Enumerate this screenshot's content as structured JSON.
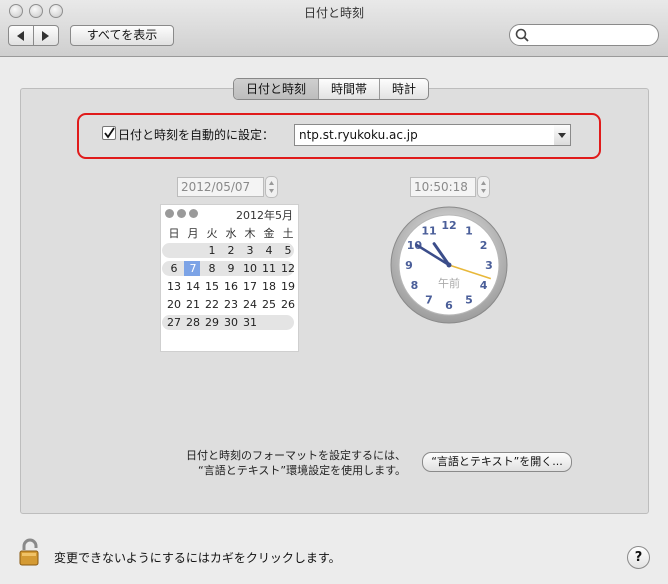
{
  "window": {
    "title": "日付と時刻"
  },
  "toolbar": {
    "show_all_label": "すべてを表示",
    "search_placeholder": ""
  },
  "tabs": [
    {
      "label": "日付と時刻",
      "selected": true
    },
    {
      "label": "時間帯",
      "selected": false
    },
    {
      "label": "時計",
      "selected": false
    }
  ],
  "auto_time": {
    "checked": true,
    "label": "日付と時刻を自動的に設定：",
    "server": "ntp.st.ryukoku.ac.jp"
  },
  "date_field": {
    "value": "2012/05/07"
  },
  "time_field": {
    "value": "10:50:18"
  },
  "calendar": {
    "month_label": "2012年5月",
    "weekdays": [
      "日",
      "月",
      "火",
      "水",
      "木",
      "金",
      "土"
    ],
    "weeks": [
      [
        "",
        "",
        "1",
        "2",
        "3",
        "4",
        "5"
      ],
      [
        "6",
        "7",
        "8",
        "9",
        "10",
        "11",
        "12"
      ],
      [
        "13",
        "14",
        "15",
        "16",
        "17",
        "18",
        "19"
      ],
      [
        "20",
        "21",
        "22",
        "23",
        "24",
        "25",
        "26"
      ],
      [
        "27",
        "28",
        "29",
        "30",
        "31",
        "",
        ""
      ]
    ],
    "selected_day": "7"
  },
  "clock": {
    "hour": 10,
    "minute": 50,
    "second": 18,
    "ampm_label": "午前",
    "numbers": [
      "12",
      "1",
      "2",
      "3",
      "4",
      "5",
      "6",
      "7",
      "8",
      "9",
      "10",
      "11"
    ]
  },
  "format_note": {
    "line1": "日付と時刻のフォーマットを設定するには、",
    "line2": "“言語とテキスト”環境設定を使用します。"
  },
  "open_lang_button": "“言語とテキスト”を開く...",
  "lock": {
    "message": "変更できないようにするにはカギをクリックします。"
  },
  "help_label": "?",
  "colors": {
    "accent_red": "#e01b1b",
    "selected_day": "#7ca3e6",
    "clock_numbers": "#4a5e99",
    "second_hand": "#e8b83a"
  }
}
